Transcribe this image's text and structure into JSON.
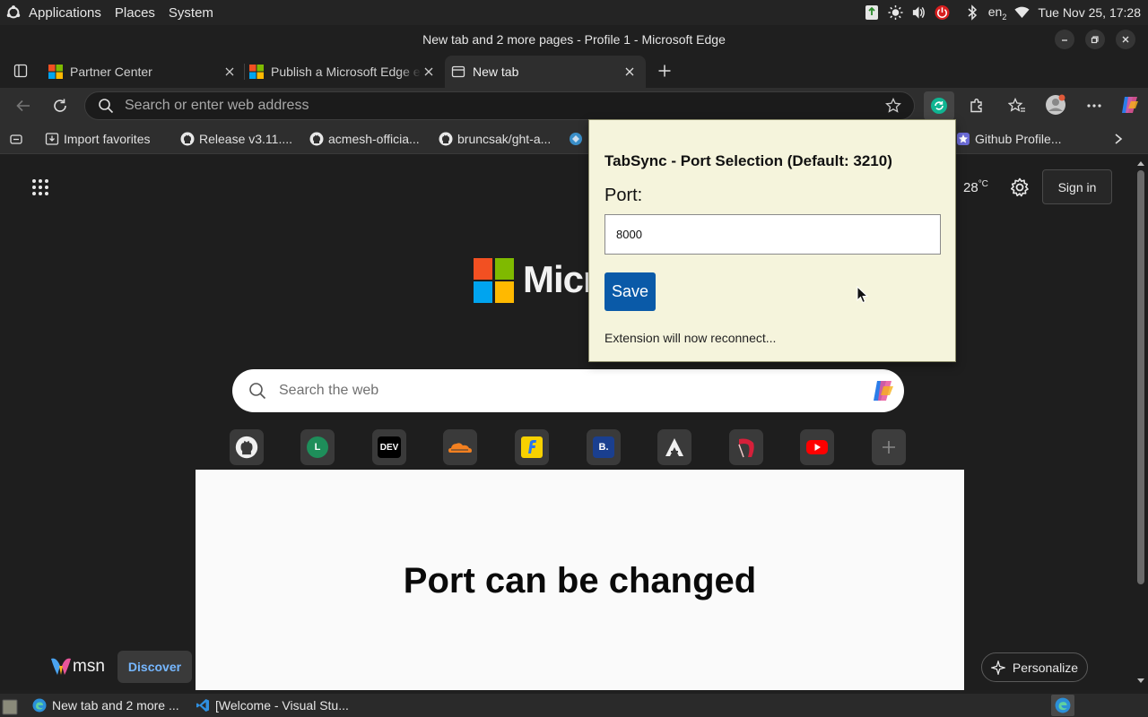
{
  "top_panel": {
    "menu": [
      "Applications",
      "Places",
      "System"
    ],
    "keyboard_layout": "en",
    "keyboard_layout_sub": "2",
    "datetime": "Tue Nov 25, 17:28"
  },
  "window": {
    "title": "New tab and 2 more pages - Profile 1 - Microsoft Edge"
  },
  "tabs": [
    {
      "label": "Partner Center",
      "active": false
    },
    {
      "label": "Publish a Microsoft Edge e",
      "active": false
    },
    {
      "label": "New tab",
      "active": true
    }
  ],
  "omnibox": {
    "placeholder": "Search or enter web address"
  },
  "favorites": [
    {
      "label": "Import favorites",
      "icon": "import-icon"
    },
    {
      "label": "Release v3.11....",
      "icon": "github-icon"
    },
    {
      "label": "acmesh-officia...",
      "icon": "github-icon"
    },
    {
      "label": "bruncsak/ght-a...",
      "icon": "github-icon"
    },
    {
      "label": "Github Profile...",
      "icon": "star-badge-icon"
    }
  ],
  "ntp": {
    "logo_text": "Micr",
    "weather_temp": "28",
    "weather_unit": "°C",
    "signin_label": "Sign in",
    "search_placeholder": "Search the web",
    "quick_links": [
      {
        "icon": "github-icon",
        "color": "#ffffff",
        "glyph": ""
      },
      {
        "icon": "letter-l-icon",
        "color": "#1e8e5a",
        "glyph": "L"
      },
      {
        "icon": "dev-icon",
        "color": "#000000",
        "glyph": "DEV"
      },
      {
        "icon": "cloudflare-icon",
        "color": "#f38020",
        "glyph": ""
      },
      {
        "icon": "flipkart-icon",
        "color": "#f7d100",
        "glyph": ""
      },
      {
        "icon": "booking-icon",
        "color": "#1a3f8f",
        "glyph": "B."
      },
      {
        "icon": "arch-icon",
        "color": "#3a3a3a",
        "glyph": ""
      },
      {
        "icon": "red-app-icon",
        "color": "#c8102e",
        "glyph": ""
      },
      {
        "icon": "youtube-icon",
        "color": "#ff0000",
        "glyph": ""
      },
      {
        "icon": "add-icon",
        "color": "#3a3a3a",
        "glyph": "+"
      }
    ],
    "msn_label": "msn",
    "discover_label": "Discover",
    "personalize_label": "Personalize"
  },
  "overlay": {
    "headline": "Port can be changed"
  },
  "popup": {
    "title": "TabSync - Port Selection (Default: 3210)",
    "port_label": "Port:",
    "port_value": "8000",
    "save_label": "Save",
    "status": "Extension will now reconnect..."
  },
  "taskbar": [
    {
      "label": "New tab and 2 more ...",
      "icon": "edge-icon"
    },
    {
      "label": "[Welcome - Visual Stu...",
      "icon": "vscode-icon"
    }
  ],
  "colors": {
    "popup_bg": "#f5f4dc",
    "save_button": "#0a5aa8",
    "dark_bg": "#1f1f1f"
  }
}
